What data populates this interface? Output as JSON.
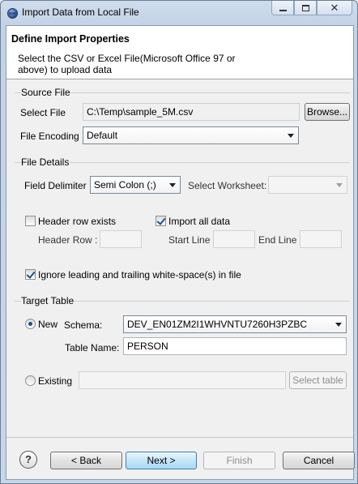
{
  "window": {
    "title": "Import Data from Local File",
    "controls": [
      "minimize-icon",
      "maximize-icon",
      "close-icon"
    ]
  },
  "header": {
    "title": "Define Import Properties",
    "description": "Select the CSV or Excel File(Microsoft Office 97 or above) to upload data"
  },
  "source_file": {
    "group_label": "Source File",
    "select_file_label": "Select File",
    "select_file_value": "C:\\Temp\\sample_5M.csv",
    "browse_label": "Browse...",
    "encoding_label": "File Encoding",
    "encoding_value": "Default"
  },
  "file_details": {
    "group_label": "File Details",
    "delimiter_label": "Field Delimiter",
    "delimiter_value": "Semi Colon (;)",
    "worksheet_label": "Select Worksheet:",
    "worksheet_value": "",
    "header_row_exists_label": "Header row exists",
    "header_row_exists_checked": false,
    "import_all_label": "Import all data",
    "import_all_checked": true,
    "header_row_label": "Header Row :",
    "header_row_value": "",
    "start_line_label": "Start Line",
    "start_line_value": "",
    "end_line_label": "End Line",
    "end_line_value": "",
    "ignore_ws_label": "Ignore leading and trailing white-space(s) in file",
    "ignore_ws_checked": true
  },
  "target_table": {
    "group_label": "Target Table",
    "new_label": "New",
    "new_selected": true,
    "schema_label": "Schema:",
    "schema_value": "DEV_EN01ZM2I1WHVNTU7260H3PZBC",
    "table_name_label": "Table Name:",
    "table_name_value": "PERSON",
    "existing_label": "Existing",
    "existing_selected": false,
    "existing_value": "",
    "select_table_label": "Select table"
  },
  "footer": {
    "help_glyph": "?",
    "back_label": "< Back",
    "next_label": "Next >",
    "finish_label": "Finish",
    "cancel_label": "Cancel"
  }
}
